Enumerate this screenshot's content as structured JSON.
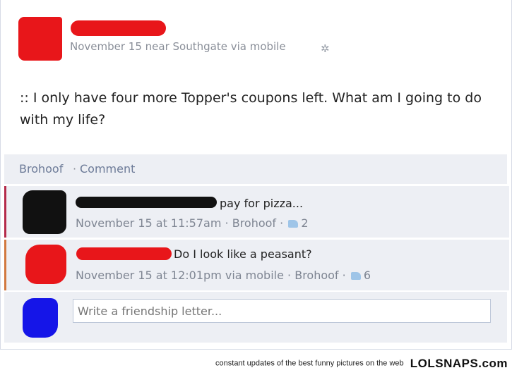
{
  "post": {
    "meta": "November 15 near Southgate via mobile",
    "options_icon": "gear-icon",
    "status": ":: I only have four more Topper's coupons left. What am I going to do with my life?",
    "actions": [
      "Brohoof",
      "Comment"
    ],
    "separator": "·"
  },
  "comments": [
    {
      "text": "pay for pizza...",
      "time": "November 15 at 11:57am",
      "brohoof": "Brohoof",
      "likes": "2"
    },
    {
      "text": "Do I look like a peasant?",
      "time": "November 15 at 12:01pm via mobile",
      "brohoof": "Brohoof",
      "likes": "6"
    }
  ],
  "composer": {
    "placeholder": "Write a friendship letter..."
  },
  "footer": {
    "tagline": "constant updates of the best funny pictures on the web",
    "brand": "LOLSNAPS.com"
  },
  "colors": {
    "redaction_red": "#e8161a",
    "redaction_black": "#111111",
    "redaction_blue": "#1515e8",
    "link": "#6d7b98",
    "comment_bg": "#edeff4"
  }
}
